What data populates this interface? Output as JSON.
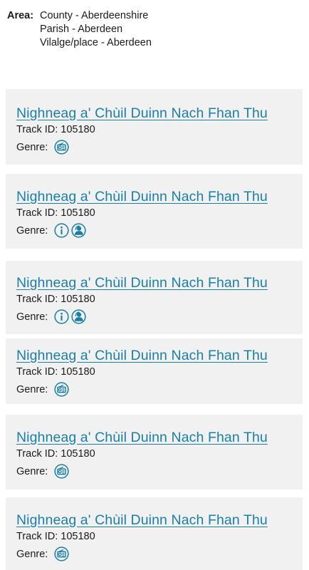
{
  "area": {
    "label": "Area:",
    "lines": [
      "County - Aberdeenshire",
      "Parish - Aberdeen",
      "Vilalge/place - Aberdeen"
    ]
  },
  "tracks": [
    {
      "title": "Nighneag a' Chùil Duinn Nach Fhan Thu",
      "track_id": "Track ID: 105180",
      "genre_label": "Genre:",
      "genre_icons": [
        "radio-icon"
      ]
    },
    {
      "title": "Nighneag a' Chùil Duinn Nach Fhan Thu",
      "track_id": "Track ID: 105180",
      "genre_label": "Genre:",
      "genre_icons": [
        "info-icon",
        "person-icon"
      ]
    },
    {
      "title": "Nighneag a' Chùil Duinn Nach Fhan Thu",
      "track_id": "Track ID: 105180",
      "genre_label": "Genre:",
      "genre_icons": [
        "info-icon",
        "person-icon"
      ]
    },
    {
      "title": "Nighneag a' Chùil Duinn Nach Fhan Thu",
      "track_id": "Track ID: 105180",
      "genre_label": "Genre:",
      "genre_icons": [
        "radio-icon"
      ]
    },
    {
      "title": "Nighneag a' Chùil Duinn Nach Fhan Thu",
      "track_id": "Track ID: 105180",
      "genre_label": "Genre:",
      "genre_icons": [
        "radio-icon"
      ]
    },
    {
      "title": "Nighneag a' Chùil Duinn Nach Fhan Thu",
      "track_id": "Track ID: 105180",
      "genre_label": "Genre:",
      "genre_icons": [
        "radio-icon"
      ]
    }
  ],
  "colors": {
    "link": "#1a7fa6",
    "icon": "#1a7fa6",
    "card_bg": "#f1f1f1"
  }
}
